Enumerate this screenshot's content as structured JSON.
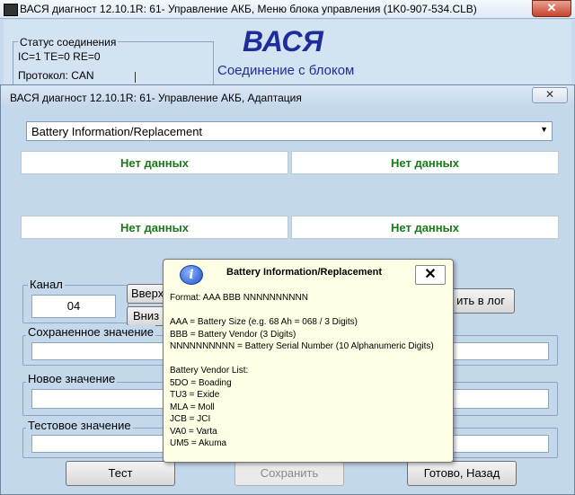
{
  "back_window": {
    "title": "ВАСЯ диагност 12.10.1R: 61- Управление АКБ,  Меню блока управления (1K0-907-534.CLB)",
    "close_glyph": "✕",
    "status_legend": "Статус соединения",
    "status_counters": "IC=1  TE=0   RE=0",
    "protocol": "Протокол: CAN",
    "brand_title": "ВАСЯ",
    "connection_label": "Соединение с блоком"
  },
  "front_window": {
    "title": "ВАСЯ диагност 12.10.1R: 61- Управление АКБ, Адаптация",
    "close_glyph": "✕",
    "dropdown": {
      "value": "Battery Information/Replacement",
      "arrow": "▼"
    },
    "no_data": [
      "Нет данных",
      "Нет данных",
      "Нет данных",
      "Нет данных"
    ],
    "channel": {
      "legend": "Канал",
      "value": "04",
      "up_label": "Вверх",
      "down_label": "Вниз"
    },
    "log_button_label": "ить в лог",
    "saved_value_legend": "Сохраненное значение",
    "new_value_legend": "Новое значение",
    "test_value_legend": "Тестовое значение",
    "buttons": {
      "test": "Тест",
      "save": "Сохранить",
      "done": "Готово, Назад"
    }
  },
  "popup": {
    "icon": "i",
    "title": "Battery Information/Replacement",
    "close_glyph": "✕",
    "lines": [
      "Format: AAA BBB NNNNNNNNNN",
      "",
      "AAA = Battery Size (e.g. 68 Ah = 068 / 3 Digits)",
      "BBB = Battery Vendor (3 Digits)",
      "NNNNNNNNNN = Battery Serial Number (10 Alphanumeric Digits)",
      "",
      "Battery Vendor List:",
      "5DO = Boading",
      "TU3 = Exide",
      "MLA = Moll",
      "JCB = JCI",
      "VA0 = Varta",
      "UM5 = Akuma"
    ]
  }
}
